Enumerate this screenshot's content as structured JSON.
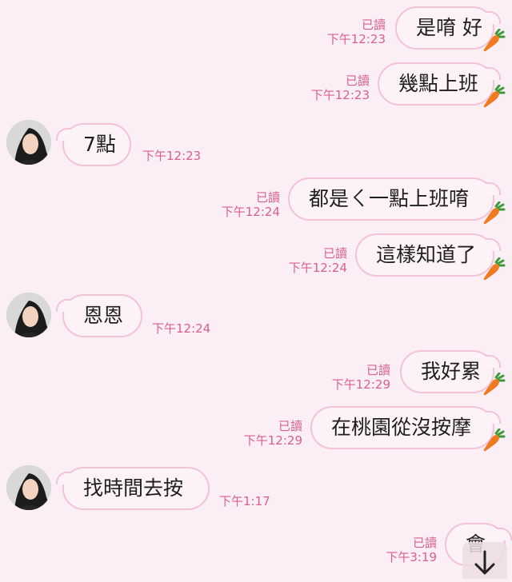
{
  "chat": {
    "messages": [
      {
        "side": "out",
        "text": "是唷 好",
        "read": "已讀",
        "time": "下午12:23"
      },
      {
        "side": "out",
        "text": "幾點上班",
        "read": "已讀",
        "time": "下午12:23"
      },
      {
        "side": "in",
        "text": "7點",
        "time": "下午12:23"
      },
      {
        "side": "out",
        "text": "都是ㄑ一點上班唷",
        "read": "已讀",
        "time": "下午12:24"
      },
      {
        "side": "out",
        "text": "這樣知道了",
        "read": "已讀",
        "time": "下午12:24"
      },
      {
        "side": "in",
        "text": "恩恩",
        "time": "下午12:24"
      },
      {
        "side": "out",
        "text": "我好累",
        "read": "已讀",
        "time": "下午12:29"
      },
      {
        "side": "out",
        "text": "在桃園從沒按摩",
        "read": "已讀",
        "time": "下午12:29"
      },
      {
        "side": "in",
        "text": "找時間去按",
        "time": "下午1:17"
      },
      {
        "side": "out",
        "text": "會",
        "read": "已讀",
        "time": "下午3:19"
      }
    ]
  },
  "colors": {
    "background": "#fbeef4",
    "bubble_fill": "#fdf3f7",
    "bubble_border": "#f2c3d6",
    "meta_text": "#d9608f",
    "carrot": "#f07a1e",
    "carrot_leaf": "#3d9a3a"
  },
  "icons": {
    "sticker": "carrot-icon",
    "scroll": "arrow-down-icon"
  }
}
